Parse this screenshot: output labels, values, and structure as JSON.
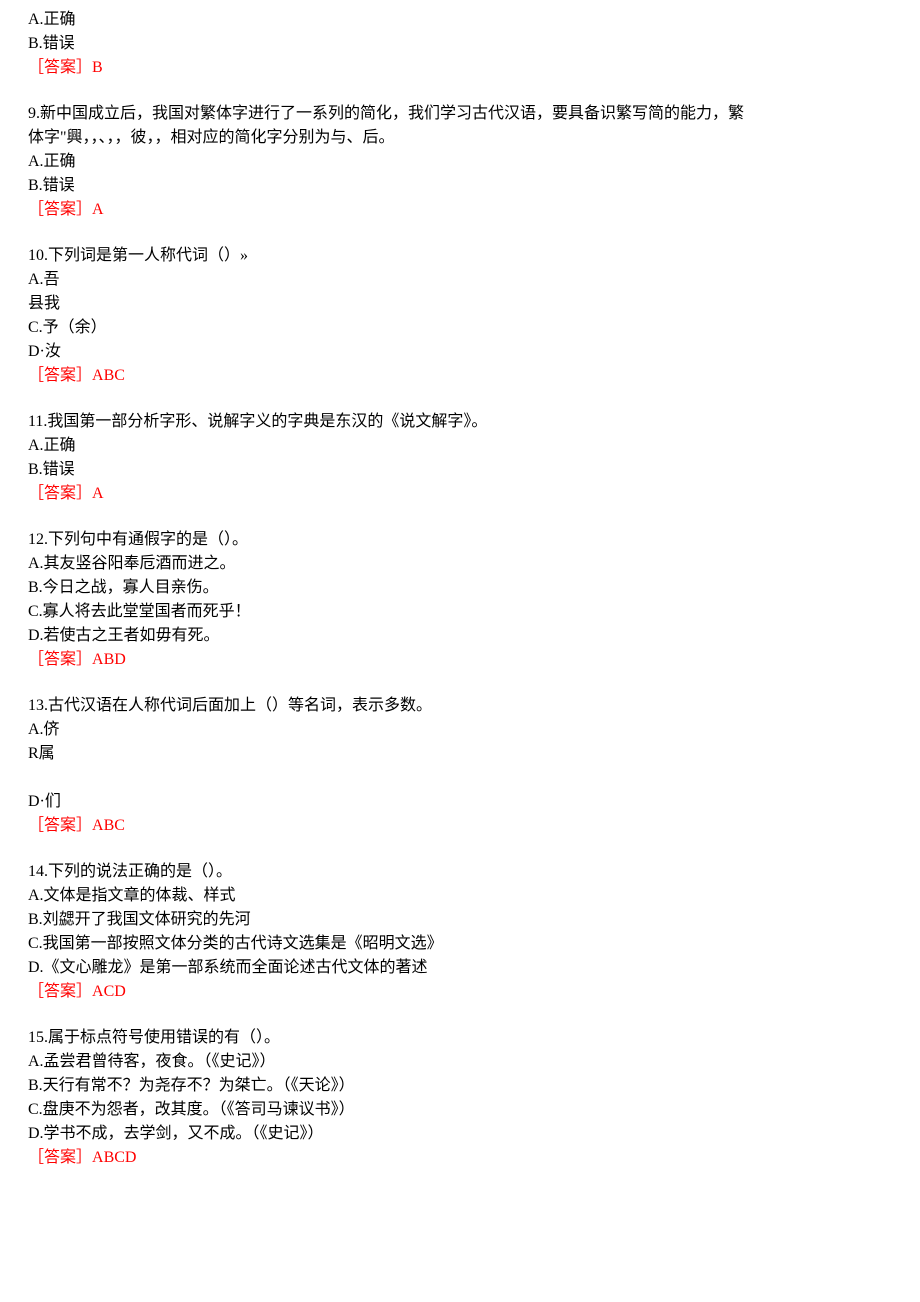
{
  "q8": {
    "options": [
      "A.正确",
      "B.错误"
    ],
    "answer_label": "［答案］",
    "answer_value": "B"
  },
  "q9": {
    "stem_line1": "9.新中国成立后，我国对繁体字进行了一系列的简化，我们学习古代汉语，要具备识繁写简的能力，繁",
    "stem_line2": "体字\"興，，、，，彼，，相对应的简化字分别为与、后。",
    "options": [
      "A.正确",
      "B.错误"
    ],
    "answer_label": "［答案］",
    "answer_value": "A"
  },
  "q10": {
    "stem": "10.下列词是第一人称代词（）»",
    "options": [
      "A.吾",
      "县我",
      "C.予（余）",
      "D·汝"
    ],
    "answer_label": "［答案］",
    "answer_value": "ABC"
  },
  "q11": {
    "stem": "11.我国第一部分析字形、说解字义的字典是东汉的《说文解字》。",
    "options": [
      "A.正确",
      "B.错误"
    ],
    "answer_label": "［答案］",
    "answer_value": "A"
  },
  "q12": {
    "stem": "12.下列句中有通假字的是（）。",
    "options": [
      "A.其友竖谷阳奉卮酒而进之。",
      "B.今日之战，寡人目亲伤。",
      "C.寡人将去此堂堂国者而死乎！",
      "D.若使古之王者如毋有死。"
    ],
    "answer_label": "［答案］",
    "answer_value": "ABD"
  },
  "q13": {
    "stem": "13.古代汉语在人称代词后面加上（）等名词，表示多数。",
    "options": [
      "A.侪",
      "R属",
      "",
      "D·们"
    ],
    "answer_label": "［答案］",
    "answer_value": "ABC"
  },
  "q14": {
    "stem": "14.下列的说法正确的是（）。",
    "options": [
      "A.文体是指文章的体裁、样式",
      "B.刘勰开了我国文体研究的先河",
      "C.我国第一部按照文体分类的古代诗文选集是《昭明文选》",
      "D.《文心雕龙》是第一部系统而全面论述古代文体的著述"
    ],
    "answer_label": "［答案］",
    "answer_value": "ACD"
  },
  "q15": {
    "stem": "15.属于标点符号使用错误的有（）。",
    "options": [
      "A.孟尝君曾待客，夜食。（《史记》）",
      "B.天行有常不？为尧存不？为桀亡。（《天论》）",
      "C.盘庚不为怨者，改其度。（《答司马谏议书》）",
      "D.学书不成，去学剑，又不成。（《史记》）"
    ],
    "answer_label": "［答案］",
    "answer_value": "ABCD"
  }
}
